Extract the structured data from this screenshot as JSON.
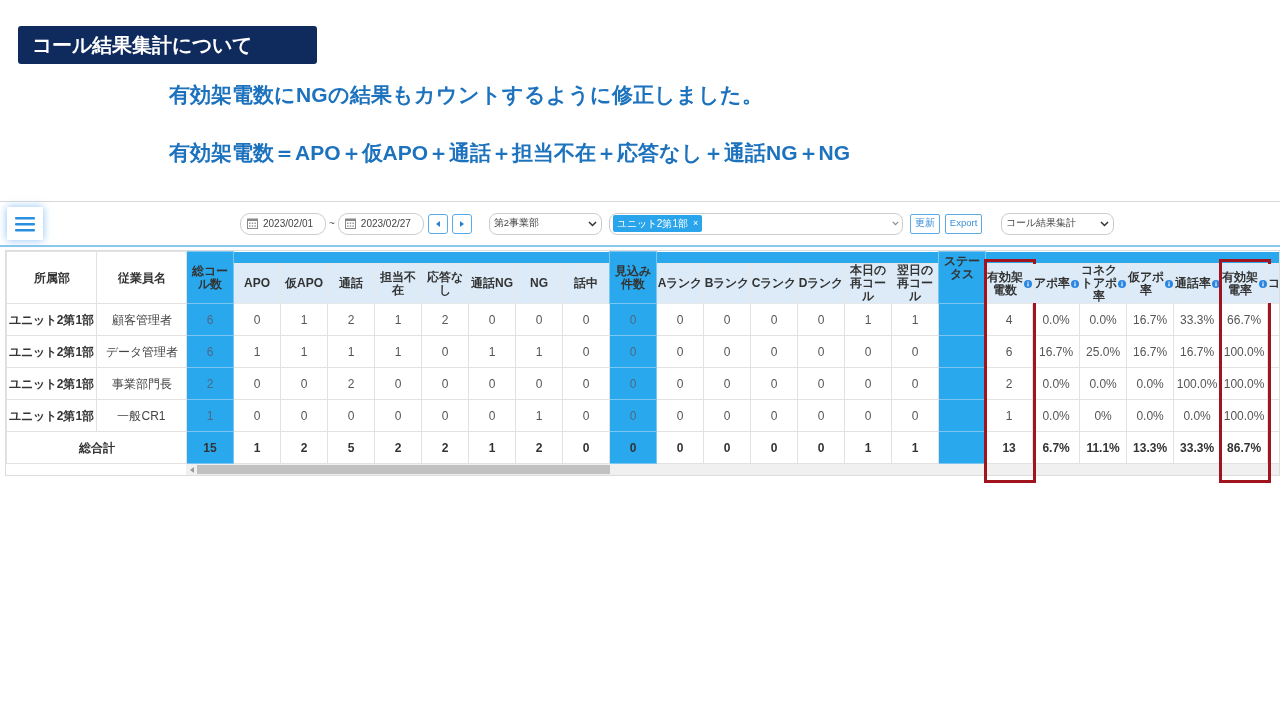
{
  "slide": {
    "title": "コール結果集計について",
    "notes": [
      "有効架電数にNGの結果もカウントするように修正しました。",
      "有効架電数＝APO＋仮APO＋通話＋担当不在＋応答なし＋通話NG＋NG"
    ]
  },
  "toolbar": {
    "date_from": "2023/02/01",
    "range_separator": "~",
    "date_to": "2023/02/27",
    "department": "第2事業部",
    "unit_tags": [
      "ユニット2第1部"
    ],
    "tag_remove": "×",
    "buttons": [
      "更新",
      "Export"
    ],
    "report": "コール結果集計"
  },
  "table": {
    "columns": [
      {
        "label": "所属部",
        "kind": "label"
      },
      {
        "label": "従業員名",
        "kind": "label"
      },
      {
        "label": "総コール数",
        "kind": "accent"
      },
      {
        "label": "APO",
        "kind": "metric"
      },
      {
        "label": "仮APO",
        "kind": "metric"
      },
      {
        "label": "通話",
        "kind": "metric"
      },
      {
        "label": "担当不在",
        "kind": "metric"
      },
      {
        "label": "応答なし",
        "kind": "metric"
      },
      {
        "label": "通話NG",
        "kind": "metric"
      },
      {
        "label": "NG",
        "kind": "metric"
      },
      {
        "label": "話中",
        "kind": "metric"
      },
      {
        "label": "見込み件数",
        "kind": "accent"
      },
      {
        "label": "Aランク",
        "kind": "metric"
      },
      {
        "label": "Bランク",
        "kind": "metric"
      },
      {
        "label": "Cランク",
        "kind": "metric"
      },
      {
        "label": "Dランク",
        "kind": "metric"
      },
      {
        "label": "本日の再コール",
        "kind": "metric"
      },
      {
        "label": "翌日の再コール",
        "kind": "metric"
      },
      {
        "label": "ステータス",
        "kind": "status"
      },
      {
        "label": "有効架電数",
        "kind": "rate",
        "highlighted": true
      },
      {
        "label": "アポ率",
        "kind": "rate",
        "highlighted": false
      },
      {
        "label": "コネクトアポ率",
        "kind": "rate",
        "highlighted": false
      },
      {
        "label": "仮アポ率",
        "kind": "rate",
        "highlighted": false
      },
      {
        "label": "通話率",
        "kind": "rate",
        "highlighted": false
      },
      {
        "label": "有効架電率",
        "kind": "rate",
        "highlighted": true
      },
      {
        "label": "コ",
        "kind": "cut"
      }
    ],
    "rows": [
      {
        "cells": [
          "ユニット2第1部",
          "顧客管理者",
          "6",
          "0",
          "1",
          "2",
          "1",
          "2",
          "0",
          "0",
          "0",
          "0",
          "0",
          "0",
          "0",
          "0",
          "1",
          "1",
          "",
          "4",
          "0.0%",
          "0.0%",
          "16.7%",
          "33.3%",
          "66.7%"
        ]
      },
      {
        "cells": [
          "ユニット2第1部",
          "データ管理者",
          "6",
          "1",
          "1",
          "1",
          "1",
          "0",
          "1",
          "1",
          "0",
          "0",
          "0",
          "0",
          "0",
          "0",
          "0",
          "0",
          "",
          "6",
          "16.7%",
          "25.0%",
          "16.7%",
          "16.7%",
          "100.0%"
        ]
      },
      {
        "cells": [
          "ユニット2第1部",
          "事業部門長",
          "2",
          "0",
          "0",
          "2",
          "0",
          "0",
          "0",
          "0",
          "0",
          "0",
          "0",
          "0",
          "0",
          "0",
          "0",
          "0",
          "",
          "2",
          "0.0%",
          "0.0%",
          "0.0%",
          "100.0%",
          "100.0%"
        ]
      },
      {
        "cells": [
          "ユニット2第1部",
          "一般CR1",
          "1",
          "0",
          "0",
          "0",
          "0",
          "0",
          "0",
          "1",
          "0",
          "0",
          "0",
          "0",
          "0",
          "0",
          "0",
          "0",
          "",
          "1",
          "0.0%",
          "0%",
          "0.0%",
          "0.0%",
          "100.0%"
        ]
      }
    ],
    "total": {
      "label": "総合計",
      "cells": [
        "15",
        "1",
        "2",
        "5",
        "2",
        "2",
        "1",
        "2",
        "0",
        "0",
        "0",
        "0",
        "0",
        "0",
        "1",
        "1",
        "",
        "13",
        "6.7%",
        "11.1%",
        "13.3%",
        "33.3%",
        "86.7%"
      ]
    }
  }
}
